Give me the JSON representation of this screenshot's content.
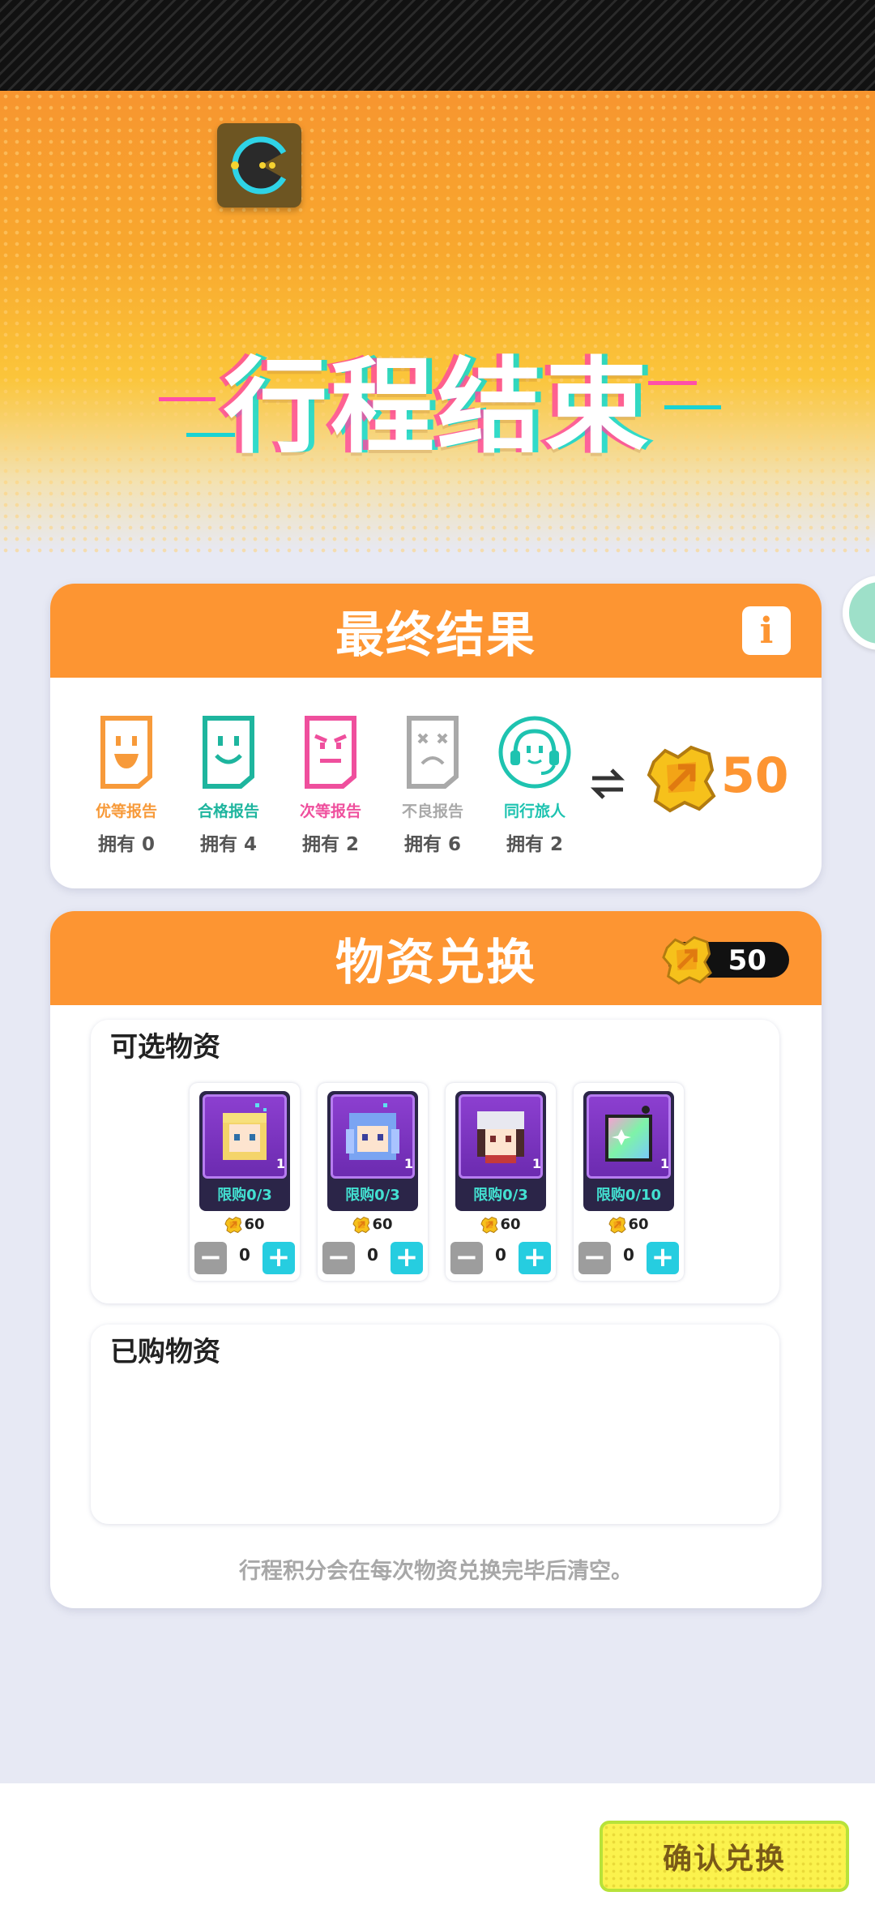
{
  "hero": {
    "title": "行程结束",
    "game_icon": "pacman-icon"
  },
  "result_card": {
    "title": "最终结果",
    "info_icon": "info-icon",
    "info_label": "i",
    "reports": [
      {
        "name": "优等报告",
        "owned": "拥有 0",
        "color": "#f79a3a",
        "icon": "happy-report-icon"
      },
      {
        "name": "合格报告",
        "owned": "拥有 4",
        "color": "#1eb59e",
        "icon": "smile-report-icon"
      },
      {
        "name": "次等报告",
        "owned": "拥有 2",
        "color": "#ef4f9d",
        "icon": "meh-report-icon"
      },
      {
        "name": "不良报告",
        "owned": "拥有 6",
        "color": "#a9a9a9",
        "icon": "sad-report-icon"
      },
      {
        "name": "同行旅人",
        "owned": "拥有 2",
        "color": "#1ec3b0",
        "icon": "companion-headset-icon"
      }
    ],
    "exchange_icon": "swap-arrows-icon",
    "points": "50"
  },
  "exchange_card": {
    "title": "物资兑换",
    "balance": "50",
    "available_title": "可选物资",
    "purchased_title": "已购物资",
    "items": [
      {
        "icon": "blonde-girl-avatar-icon",
        "qty": "1",
        "limit": "限购0/3",
        "price": "60",
        "count": "0"
      },
      {
        "icon": "blue-hair-girl-avatar-icon",
        "qty": "1",
        "limit": "限购0/3",
        "price": "60",
        "count": "0"
      },
      {
        "icon": "cap-girl-avatar-icon",
        "qty": "1",
        "limit": "限购0/3",
        "price": "60",
        "count": "0"
      },
      {
        "icon": "rainbow-crystal-icon",
        "qty": "1",
        "limit": "限购0/10",
        "price": "60",
        "count": "0"
      }
    ],
    "footnote": "行程积分会在每次物资兑换完毕后清空。"
  },
  "footer": {
    "confirm_label": "确认兑换"
  },
  "colors": {
    "accent": "#fd9532",
    "teal": "#26cde0",
    "confirm": "#fbf24d"
  }
}
